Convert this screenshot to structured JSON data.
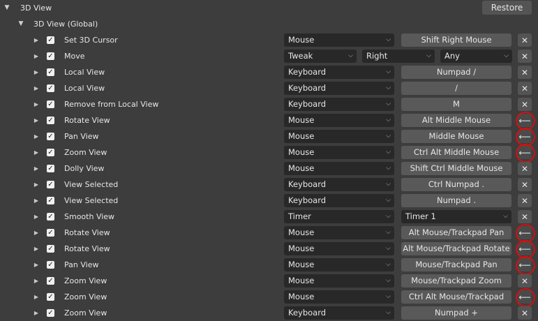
{
  "header": {
    "title": "3D View",
    "restore_label": "Restore"
  },
  "subheader": {
    "title": "3D View (Global)"
  },
  "rows": [
    {
      "name": "Set 3D Cursor",
      "type": "Mouse",
      "key": "Shift Right Mouse",
      "action": "remove"
    },
    {
      "name": "Move",
      "type": "Tweak",
      "direction": "Right",
      "modifier": "Any",
      "action": "remove"
    },
    {
      "name": "Local View",
      "type": "Keyboard",
      "key": "Numpad /",
      "action": "remove"
    },
    {
      "name": "Local View",
      "type": "Keyboard",
      "key": "/",
      "action": "remove"
    },
    {
      "name": "Remove from Local View",
      "type": "Keyboard",
      "key": "M",
      "action": "remove"
    },
    {
      "name": "Rotate View",
      "type": "Mouse",
      "key": "Alt Middle Mouse",
      "action": "restore"
    },
    {
      "name": "Pan View",
      "type": "Mouse",
      "key": "Middle Mouse",
      "action": "restore"
    },
    {
      "name": "Zoom View",
      "type": "Mouse",
      "key": "Ctrl Alt Middle Mouse",
      "action": "restore"
    },
    {
      "name": "Dolly View",
      "type": "Mouse",
      "key": "Shift Ctrl Middle Mouse",
      "action": "remove"
    },
    {
      "name": "View Selected",
      "type": "Keyboard",
      "key": "Ctrl Numpad .",
      "action": "remove"
    },
    {
      "name": "View Selected",
      "type": "Keyboard",
      "key": "Numpad .",
      "action": "remove"
    },
    {
      "name": "Smooth View",
      "type": "Timer",
      "timer": "Timer 1",
      "action": "remove"
    },
    {
      "name": "Rotate View",
      "type": "Mouse",
      "key": "Alt Mouse/Trackpad Pan",
      "action": "restore"
    },
    {
      "name": "Rotate View",
      "type": "Mouse",
      "key": "Alt Mouse/Trackpad Rotate",
      "action": "restore"
    },
    {
      "name": "Pan View",
      "type": "Mouse",
      "key": "Mouse/Trackpad Pan",
      "action": "restore"
    },
    {
      "name": "Zoom View",
      "type": "Mouse",
      "key": "Mouse/Trackpad Zoom",
      "action": "remove"
    },
    {
      "name": "Zoom View",
      "type": "Mouse",
      "key": "Ctrl Alt Mouse/Trackpad Pan",
      "action": "restore"
    },
    {
      "name": "Zoom View",
      "type": "Keyboard",
      "key": "Numpad +",
      "action": "remove"
    }
  ],
  "icons": {
    "expanded": "triangle-down",
    "collapsed": "triangle-right",
    "remove": "x-icon",
    "restore": "arrow-left-icon",
    "checkbox": "checkmark"
  },
  "colors": {
    "background": "#3d3d3d",
    "dropdown": "#282828",
    "key_button": "#595959",
    "highlight_circle": "#d41010"
  }
}
